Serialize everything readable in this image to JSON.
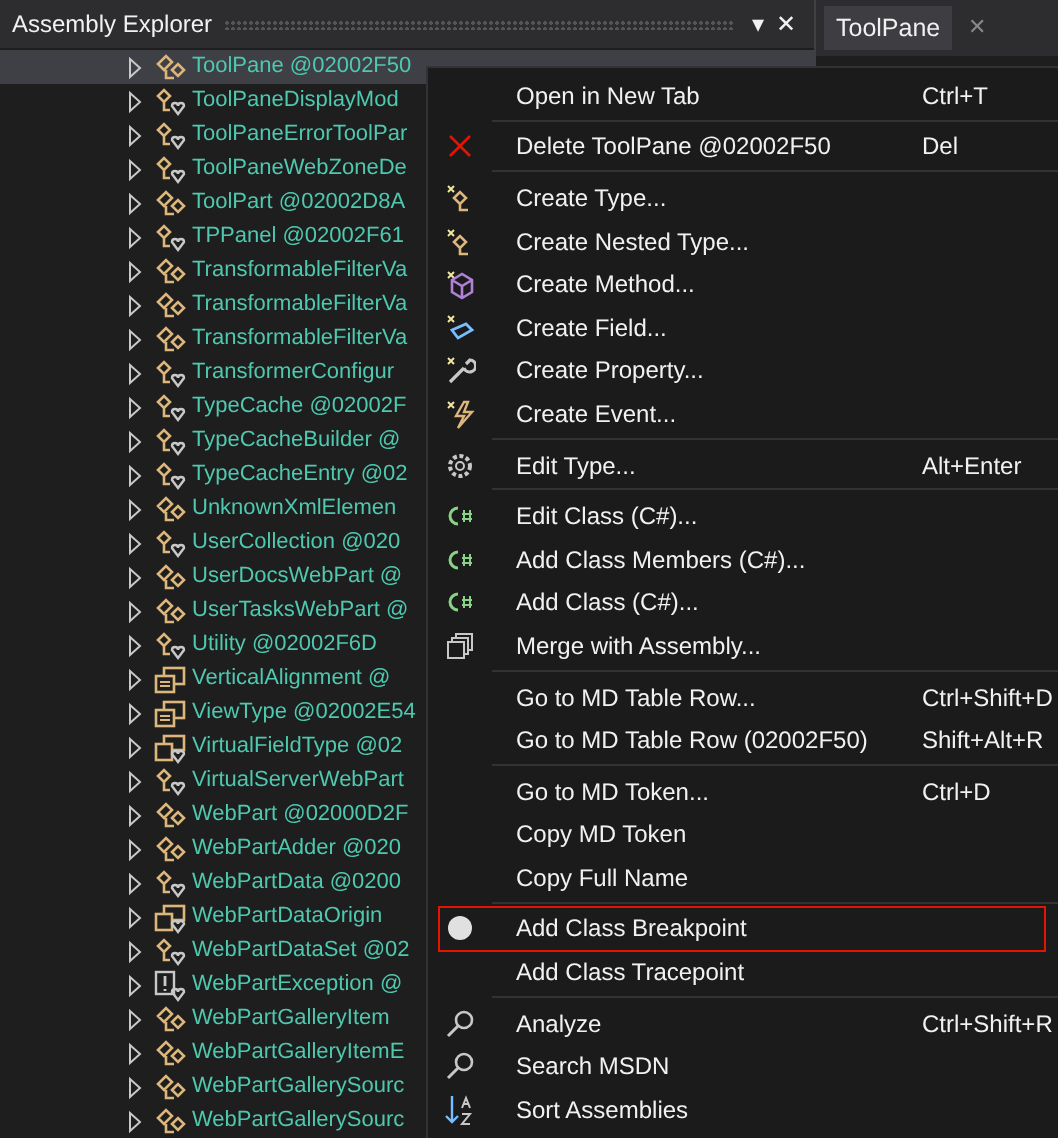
{
  "panel": {
    "title": "Assembly Explorer",
    "menu_glyph": "▾",
    "close_glyph": "✕"
  },
  "tab": {
    "label": "ToolPane",
    "close_glyph": "✕",
    "selected": true
  },
  "tree": [
    {
      "label": "ToolPane @02002F50",
      "kind": "class",
      "selected": true
    },
    {
      "label": "ToolPaneDisplayMod",
      "kind": "class-internal",
      "selected": false
    },
    {
      "label": "ToolPaneErrorToolPar",
      "kind": "class-internal",
      "selected": false
    },
    {
      "label": "ToolPaneWebZoneDe",
      "kind": "class-internal",
      "selected": false
    },
    {
      "label": "ToolPart @02002D8A",
      "kind": "class",
      "selected": false
    },
    {
      "label": "TPPanel @02002F61",
      "kind": "class-internal",
      "selected": false
    },
    {
      "label": "TransformableFilterVa",
      "kind": "class",
      "selected": false
    },
    {
      "label": "TransformableFilterVa",
      "kind": "class",
      "selected": false
    },
    {
      "label": "TransformableFilterVa",
      "kind": "class",
      "selected": false
    },
    {
      "label": "TransformerConfigur",
      "kind": "class-internal",
      "selected": false
    },
    {
      "label": "TypeCache @02002F",
      "kind": "class-internal",
      "selected": false
    },
    {
      "label": "TypeCacheBuilder @",
      "kind": "class-internal",
      "selected": false
    },
    {
      "label": "TypeCacheEntry @02",
      "kind": "class-internal",
      "selected": false
    },
    {
      "label": "UnknownXmlElemen",
      "kind": "class",
      "selected": false
    },
    {
      "label": "UserCollection @020",
      "kind": "class-internal",
      "selected": false
    },
    {
      "label": "UserDocsWebPart @",
      "kind": "class",
      "selected": false
    },
    {
      "label": "UserTasksWebPart @",
      "kind": "class",
      "selected": false
    },
    {
      "label": "Utility @02002F6D",
      "kind": "class-internal",
      "selected": false
    },
    {
      "label": "VerticalAlignment @",
      "kind": "enum",
      "selected": false
    },
    {
      "label": "ViewType @02002E54",
      "kind": "enum",
      "selected": false
    },
    {
      "label": "VirtualFieldType @02",
      "kind": "enum-internal",
      "selected": false
    },
    {
      "label": "VirtualServerWebPart",
      "kind": "class-internal",
      "selected": false
    },
    {
      "label": "WebPart @02000D2F",
      "kind": "class",
      "selected": false
    },
    {
      "label": "WebPartAdder @020",
      "kind": "class",
      "selected": false
    },
    {
      "label": "WebPartData @0200",
      "kind": "class-internal",
      "selected": false
    },
    {
      "label": "WebPartDataOrigin",
      "kind": "enum-internal",
      "selected": false
    },
    {
      "label": "WebPartDataSet @02",
      "kind": "class-internal",
      "selected": false
    },
    {
      "label": "WebPartException @",
      "kind": "exception",
      "selected": false
    },
    {
      "label": "WebPartGalleryItem",
      "kind": "class",
      "selected": false
    },
    {
      "label": "WebPartGalleryItemE",
      "kind": "class",
      "selected": false
    },
    {
      "label": "WebPartGallerySourc",
      "kind": "class",
      "selected": false
    },
    {
      "label": "WebPartGallerySourc",
      "kind": "class",
      "selected": false
    }
  ],
  "context_menu": [
    [
      {
        "label": "Open in New Tab",
        "shortcut": "Ctrl+T",
        "kind": "plain",
        "highlighted": false
      }
    ],
    [
      {
        "label": "Delete ToolPane @02002F50",
        "shortcut": "Del",
        "kind": "delete",
        "highlighted": false
      }
    ],
    [
      {
        "label": "Create Type...",
        "kind": "create-type",
        "highlighted": false
      },
      {
        "label": "Create Nested Type...",
        "kind": "create-type",
        "highlighted": false
      },
      {
        "label": "Create Method...",
        "kind": "create-method",
        "highlighted": false
      },
      {
        "label": "Create Field...",
        "kind": "create-field",
        "highlighted": false
      },
      {
        "label": "Create Property...",
        "kind": "create-property",
        "highlighted": false
      },
      {
        "label": "Create Event...",
        "kind": "create-event",
        "highlighted": false
      }
    ],
    [
      {
        "label": "Edit Type...",
        "shortcut": "Alt+Enter",
        "kind": "gear",
        "highlighted": false
      }
    ],
    [
      {
        "label": "Edit Class (C#)...",
        "kind": "csharp",
        "highlighted": false
      },
      {
        "label": "Add Class Members (C#)...",
        "kind": "csharp",
        "highlighted": false
      },
      {
        "label": "Add Class (C#)...",
        "kind": "csharp",
        "highlighted": false
      },
      {
        "label": "Merge with Assembly...",
        "kind": "merge",
        "highlighted": false
      }
    ],
    [
      {
        "label": "Go to MD Table Row...",
        "shortcut": "Ctrl+Shift+D",
        "kind": "plain",
        "highlighted": false
      },
      {
        "label": "Go to MD Table Row (02002F50)",
        "shortcut": "Shift+Alt+R",
        "kind": "plain",
        "highlighted": false
      }
    ],
    [
      {
        "label": "Go to MD Token...",
        "shortcut": "Ctrl+D",
        "kind": "plain",
        "highlighted": false
      },
      {
        "label": "Copy MD Token",
        "kind": "plain",
        "highlighted": false
      },
      {
        "label": "Copy Full Name",
        "kind": "plain",
        "highlighted": false
      }
    ],
    [
      {
        "label": "Add Class Breakpoint",
        "kind": "breakpoint",
        "highlighted": true
      },
      {
        "label": "Add Class Tracepoint",
        "kind": "plain",
        "highlighted": false
      }
    ],
    [
      {
        "label": "Analyze",
        "shortcut": "Ctrl+Shift+R",
        "kind": "search",
        "highlighted": false
      },
      {
        "label": "Search MSDN",
        "kind": "search",
        "highlighted": false
      },
      {
        "label": "Sort Assemblies",
        "kind": "sort",
        "highlighted": false
      }
    ]
  ]
}
